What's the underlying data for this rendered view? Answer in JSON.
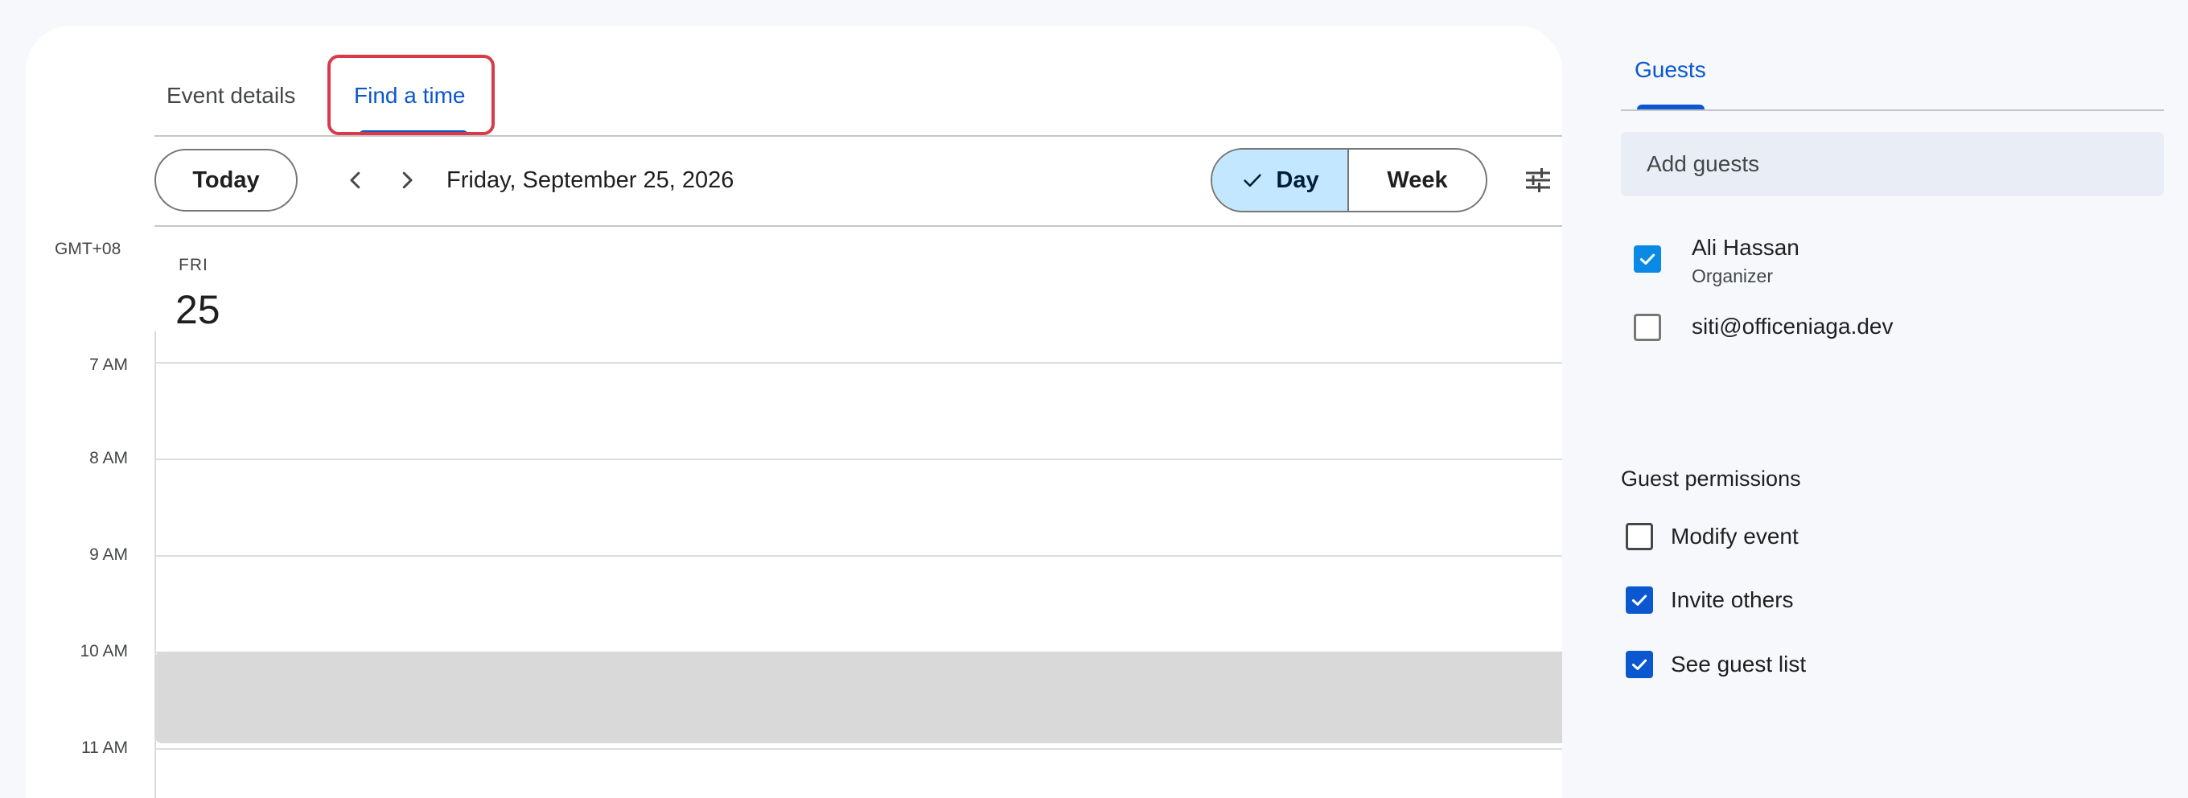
{
  "tabs": {
    "event_details": "Event details",
    "find_a_time": "Find a time"
  },
  "toolbar": {
    "today_label": "Today",
    "date": "Friday, September 25, 2026",
    "view_day": "Day",
    "view_week": "Week",
    "selected_view": "Day"
  },
  "calendar": {
    "timezone": "GMT+08",
    "day_of_week": "FRI",
    "day_number": "25",
    "hours": [
      "7 AM",
      "8 AM",
      "9 AM",
      "10 AM",
      "11 AM"
    ]
  },
  "sidebar": {
    "tab": "Guests",
    "add_guests_placeholder": "Add guests",
    "guests": [
      {
        "name": "Ali Hassan",
        "role": "Organizer",
        "checked": true
      },
      {
        "name": "siti@officeniaga.dev",
        "role": "",
        "checked": false
      }
    ],
    "permissions_title": "Guest permissions",
    "permissions": [
      {
        "label": "Modify event",
        "checked": false
      },
      {
        "label": "Invite others",
        "checked": true
      },
      {
        "label": "See guest list",
        "checked": true
      }
    ]
  },
  "colors": {
    "accent": "#0b57d0",
    "selected_segment": "#c2e7ff",
    "highlight_box": "#d93a4a",
    "busy_block": "#d9d9d9"
  },
  "icons": {
    "prev": "chevron-left-icon",
    "next": "chevron-right-icon",
    "check": "check-icon",
    "settings": "tune-icon"
  }
}
